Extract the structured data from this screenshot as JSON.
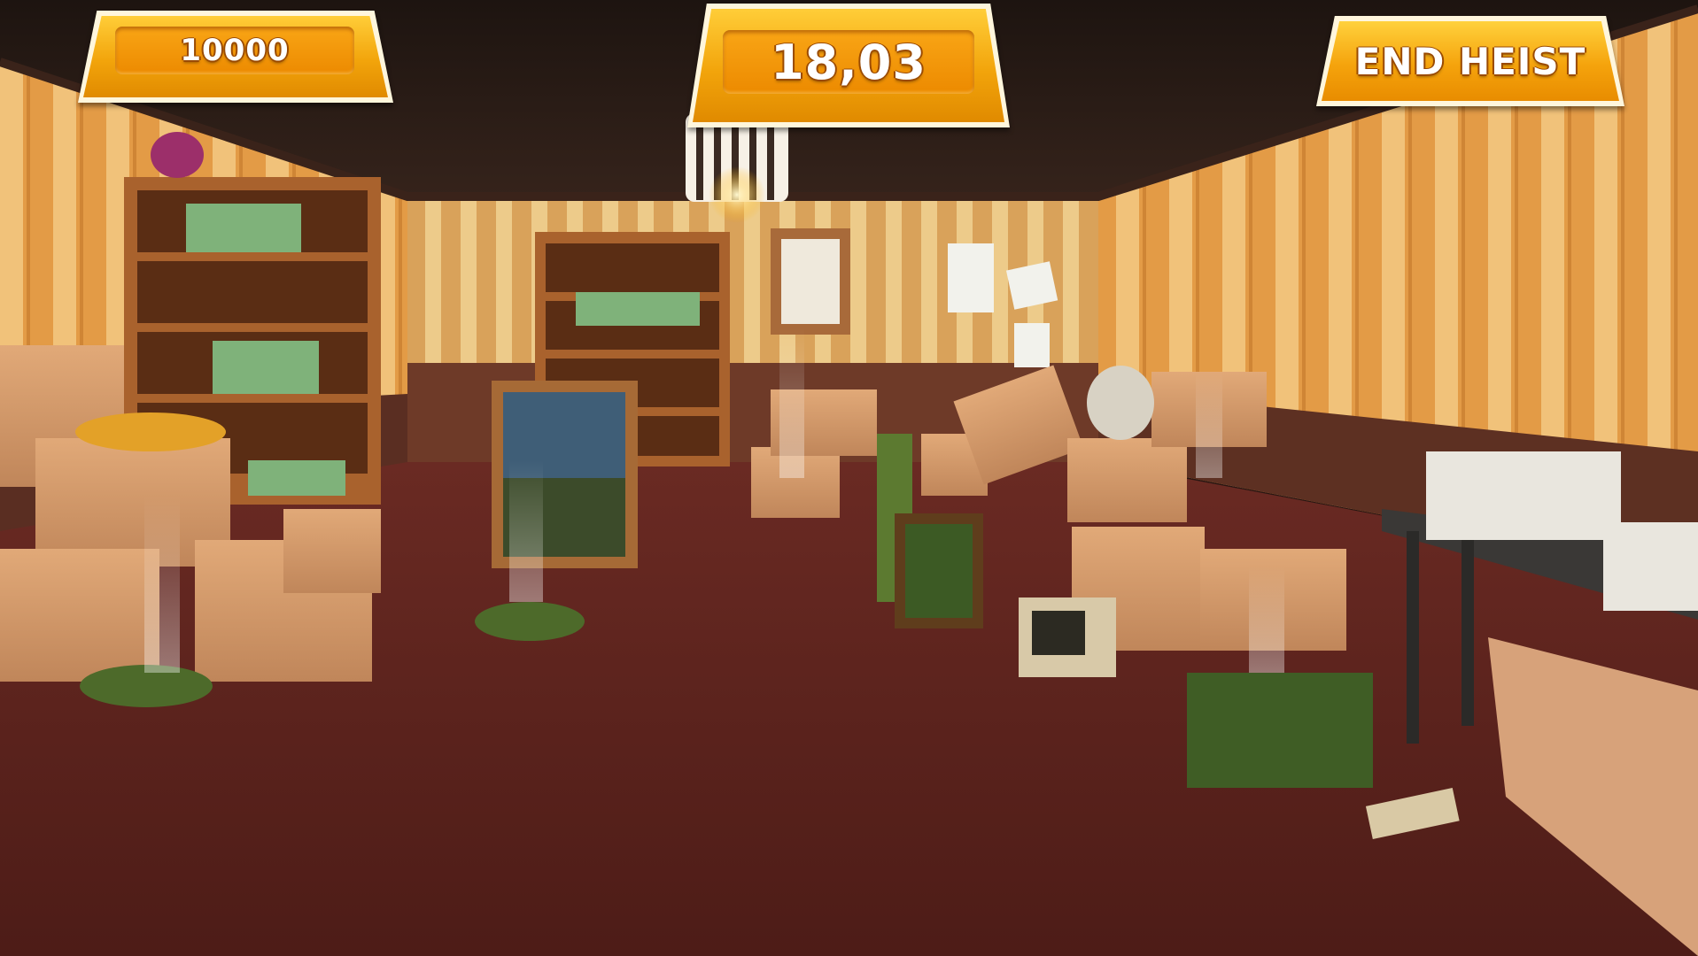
{
  "hud": {
    "score": "10000",
    "timer": "18,03",
    "end_button_label": "END HEIST"
  },
  "colors": {
    "hud_orange": "#f2a40b",
    "hud_dark_orange": "#e08a00",
    "hud_outline": "#fff6dc",
    "wallpaper": "#e6a24e",
    "carpet": "#6b2a22"
  }
}
